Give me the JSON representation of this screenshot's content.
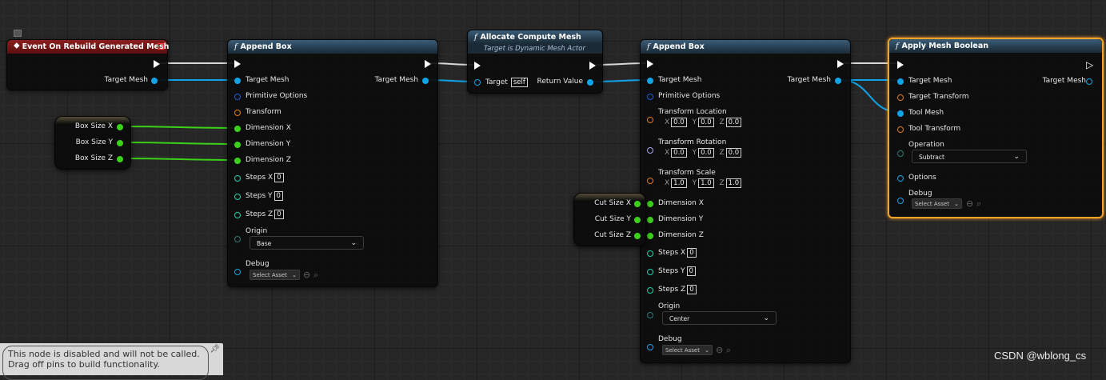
{
  "nodes": {
    "event": {
      "title": "Event On Rebuild Generated Mesh",
      "pin_target_mesh": "Target Mesh"
    },
    "append_box_1": {
      "title": "Append Box",
      "out_target_mesh": "Target Mesh",
      "pins": {
        "target_mesh": "Target Mesh",
        "primitive_options": "Primitive Options",
        "transform": "Transform",
        "dimension_x": "Dimension X",
        "dimension_y": "Dimension Y",
        "dimension_z": "Dimension Z",
        "steps_x": "Steps X",
        "steps_y": "Steps Y",
        "steps_z": "Steps Z",
        "origin": "Origin",
        "debug": "Debug"
      },
      "steps_x_value": "0",
      "steps_y_value": "0",
      "steps_z_value": "0",
      "origin_value": "Base",
      "debug_value": "Select Asset"
    },
    "allocate": {
      "title": "Allocate Compute Mesh",
      "subtitle": "Target is Dynamic Mesh Actor",
      "target_label": "Target",
      "target_value": "self",
      "return_label": "Return Value"
    },
    "append_box_2": {
      "title": "Append Box",
      "out_target_mesh": "Target Mesh",
      "pins": {
        "target_mesh": "Target Mesh",
        "primitive_options": "Primitive Options",
        "transform_location": "Transform Location",
        "transform_rotation": "Transform Rotation",
        "transform_scale": "Transform Scale",
        "dimension_x": "Dimension X",
        "dimension_y": "Dimension Y",
        "dimension_z": "Dimension Z",
        "steps_x": "Steps X",
        "steps_y": "Steps Y",
        "steps_z": "Steps Z",
        "origin": "Origin",
        "debug": "Debug"
      },
      "location": {
        "x": "0.0",
        "y": "0.0",
        "z": "0.0"
      },
      "rotation": {
        "x": "0.0",
        "y": "0.0",
        "z": "0.0"
      },
      "scale": {
        "x": "1.0",
        "y": "1.0",
        "z": "1.0"
      },
      "steps_x_value": "0",
      "steps_y_value": "0",
      "steps_z_value": "0",
      "origin_value": "Center",
      "debug_value": "Select Asset"
    },
    "boolean": {
      "title": "Apply Mesh Boolean",
      "out_target_mesh": "Target Mesh",
      "pins": {
        "target_mesh": "Target Mesh",
        "target_transform": "Target Transform",
        "tool_mesh": "Tool Mesh",
        "tool_transform": "Tool Transform",
        "operation": "Operation",
        "options": "Options",
        "debug": "Debug"
      },
      "operation_value": "Subtract",
      "debug_value": "Select Asset"
    }
  },
  "axis_labels": {
    "x": "X",
    "y": "Y",
    "z": "Z"
  },
  "variables": {
    "box_size_x": "Box Size X",
    "box_size_y": "Box Size Y",
    "box_size_z": "Box Size Z",
    "cut_size_x": "Cut Size X",
    "cut_size_y": "Cut Size Y",
    "cut_size_z": "Cut Size Z"
  },
  "tooltip": {
    "line1": "This node is disabled and will not be called.",
    "line2": "Drag off pins to build functionality."
  },
  "watermark": "CSDN @wblong_cs",
  "colors": {
    "exec_wire": "#ffffff",
    "mesh_wire": "#0fa4e8",
    "float_wire": "#3bd118",
    "selection": "#f4a327",
    "event_header": "#8c1e1e",
    "function_header": "#3b5c78"
  }
}
